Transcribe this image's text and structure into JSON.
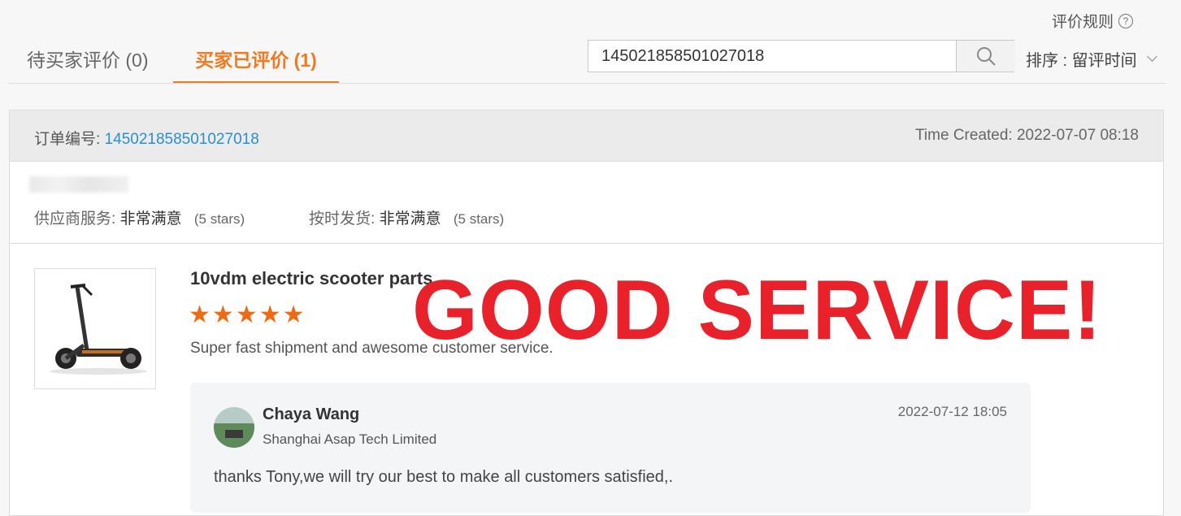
{
  "header": {
    "rules_label": "评价规则",
    "help_icon": "help-circle-icon"
  },
  "tabs": [
    {
      "label": "待买家评价 (0)",
      "active": false
    },
    {
      "label": "买家已评价 (1)",
      "active": true
    }
  ],
  "search": {
    "value": "145021858501027018",
    "button_icon": "search-icon"
  },
  "sort": {
    "label": "排序 : 留评时间",
    "icon": "chevron-down-icon"
  },
  "order": {
    "number_label": "订单编号:",
    "number": "145021858501027018",
    "created_label": "Time Created:",
    "created": "2022-07-07 08:18",
    "ratings": [
      {
        "label": "供应商服务:",
        "value": "非常满意",
        "note": "(5 stars)"
      },
      {
        "label": "按时发货:",
        "value": "非常满意",
        "note": "(5 stars)"
      }
    ]
  },
  "product": {
    "title": "10vdm electric scooter parts",
    "stars": 5,
    "star_char": "★",
    "comment": "Super fast shipment and awesome customer service."
  },
  "overlay": {
    "text": "GOOD SERVICE!",
    "color": "#e8212b"
  },
  "reply": {
    "name": "Chaya Wang",
    "company": "Shanghai Asap Tech Limited",
    "date": "2022-07-12 18:05",
    "text": "thanks Tony,we will try our best to make all customers satisfied,."
  },
  "colors": {
    "accent": "#ef7a22",
    "link": "#2a8fce",
    "star": "#ef6b13"
  }
}
